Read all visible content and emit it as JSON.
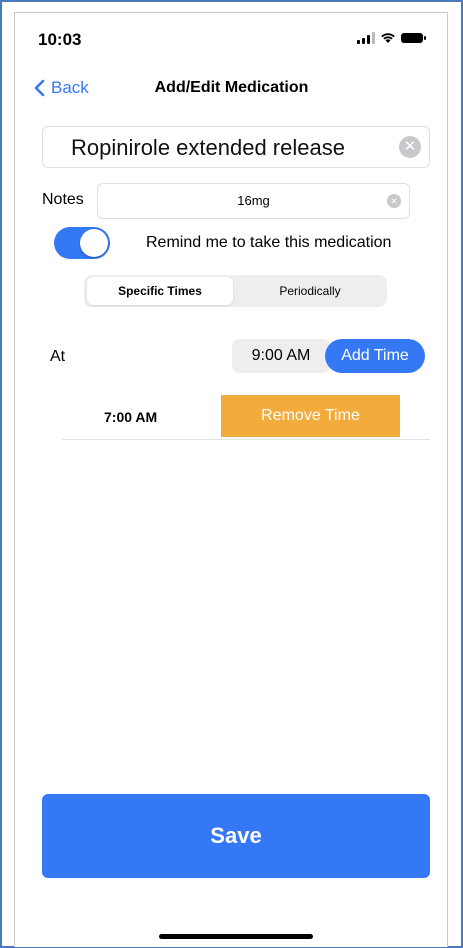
{
  "status_bar": {
    "time": "10:03"
  },
  "nav": {
    "back_label": "Back",
    "title": "Add/Edit Medication"
  },
  "medication": {
    "name": "Ropinirole extended release"
  },
  "notes": {
    "label": "Notes",
    "value": "16mg"
  },
  "reminder": {
    "label": "Remind me to take this medication",
    "enabled": true
  },
  "schedule_tabs": [
    {
      "label": "Specific Times",
      "selected": true
    },
    {
      "label": "Periodically",
      "selected": false
    }
  ],
  "time_entry": {
    "at_label": "At",
    "time_value": "9:00 AM",
    "add_label": "Add Time"
  },
  "times": [
    {
      "time": "7:00 AM",
      "remove_label": "Remove Time"
    }
  ],
  "save_label": "Save",
  "colors": {
    "accent": "#3478f6",
    "remove": "#f3ab3c",
    "frame": "#4a7ab8"
  },
  "icons": {
    "back": "chevron-left-icon",
    "clear": "clear-circle-icon",
    "signal": "signal-bars-icon",
    "wifi": "wifi-icon",
    "battery": "battery-icon"
  }
}
